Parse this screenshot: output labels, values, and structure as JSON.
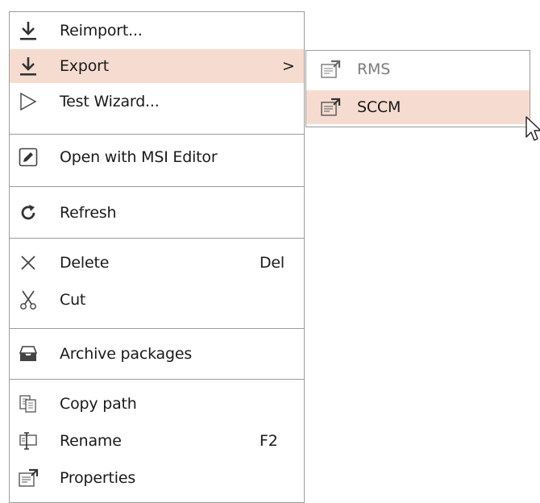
{
  "context_menu": {
    "items": [
      {
        "label": "Reimport...",
        "icon": "import-down-arrow-icon"
      },
      {
        "label": "Export",
        "icon": "export-down-arrow-icon",
        "submenu_arrow": ">"
      },
      {
        "label": "Test Wizard...",
        "icon": "play-triangle-icon"
      },
      {
        "label": "Open with MSI Editor",
        "icon": "pencil-edit-icon"
      },
      {
        "label": "Refresh",
        "icon": "refresh-icon"
      },
      {
        "label": "Delete",
        "icon": "delete-x-icon",
        "shortcut": "Del"
      },
      {
        "label": "Cut",
        "icon": "scissors-icon"
      },
      {
        "label": "Archive packages",
        "icon": "archive-tray-icon"
      },
      {
        "label": "Copy path",
        "icon": "copy-icon"
      },
      {
        "label": "Rename",
        "icon": "rename-icon",
        "shortcut": "F2"
      },
      {
        "label": "Properties",
        "icon": "properties-icon"
      }
    ]
  },
  "export_submenu": {
    "items": [
      {
        "label": "RMS",
        "icon": "package-properties-icon",
        "disabled": true
      },
      {
        "label": "SCCM",
        "icon": "package-properties-icon",
        "highlighted": true
      }
    ]
  },
  "colors": {
    "highlight": "#f6dcd0",
    "border": "#9c9c9c",
    "text": "#1a1a1a",
    "disabled_text": "#7c7c7c"
  }
}
